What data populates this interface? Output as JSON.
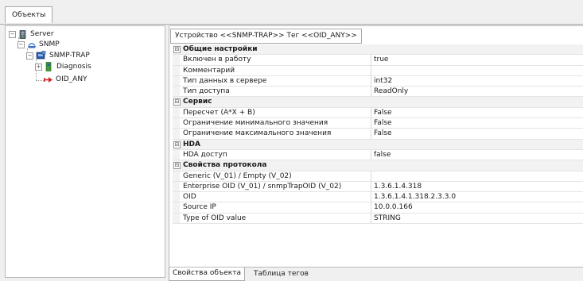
{
  "window": {
    "objects_tab": "Объекты"
  },
  "tree": {
    "nodes": [
      {
        "label": "Server",
        "icon": "server-icon"
      },
      {
        "label": "SNMP",
        "icon": "snmp-driver-icon"
      },
      {
        "label": "SNMP-TRAP",
        "icon": "device-icon"
      },
      {
        "label": "Diagnosis",
        "icon": "diagnosis-icon"
      },
      {
        "label": "OID_ANY",
        "icon": "tag-icon"
      }
    ]
  },
  "panel": {
    "title": "Устройство <<SNMP-TRAP>> Тег  <<OID_ANY>>",
    "rows": [
      {
        "type": "category",
        "label": "Общие настройки",
        "expander": "⊟"
      },
      {
        "type": "prop",
        "label": "Включен в работу",
        "value": "true"
      },
      {
        "type": "prop",
        "label": "Комментарий",
        "value": ""
      },
      {
        "type": "prop",
        "label": "Тип данных в сервере",
        "value": "int32"
      },
      {
        "type": "prop",
        "label": "Тип доступа",
        "value": "ReadOnly"
      },
      {
        "type": "category",
        "label": "Сервис",
        "expander": "⊟"
      },
      {
        "type": "prop",
        "label": "Пересчет (A*X + B)",
        "value": "False"
      },
      {
        "type": "prop",
        "label": "Ограничение минимального значения",
        "value": "False"
      },
      {
        "type": "prop",
        "label": "Ограничение максимального значения",
        "value": "False"
      },
      {
        "type": "category",
        "label": "HDA",
        "expander": "⊟"
      },
      {
        "type": "prop",
        "label": "HDA доступ",
        "value": "false"
      },
      {
        "type": "category",
        "label": "Свойства протокола",
        "expander": "⊟"
      },
      {
        "type": "prop",
        "label": "Generic (V_01) / Empty (V_02)",
        "value": ""
      },
      {
        "type": "prop",
        "label": "Enterprise OID (V_01) / snmpTrapOID (V_02)",
        "value": "1.3.6.1.4.318"
      },
      {
        "type": "prop",
        "label": "OID",
        "value": "1.3.6.1.4.1.318.2.3.3.0"
      },
      {
        "type": "prop",
        "label": "Source IP",
        "value": "10.0.0.166"
      },
      {
        "type": "prop",
        "label": "Type of OID value",
        "value": "STRING"
      }
    ]
  },
  "bottom_tabs": [
    {
      "label": "Свойства объекта",
      "active": true
    },
    {
      "label": "Таблица тегов",
      "active": false
    }
  ],
  "colors": {
    "tag_arrow": "#d0282a",
    "snmp_blue": "#3a6fc4",
    "device_blue": "#2a5aa8",
    "diagnosis_green": "#3d9a3d"
  }
}
